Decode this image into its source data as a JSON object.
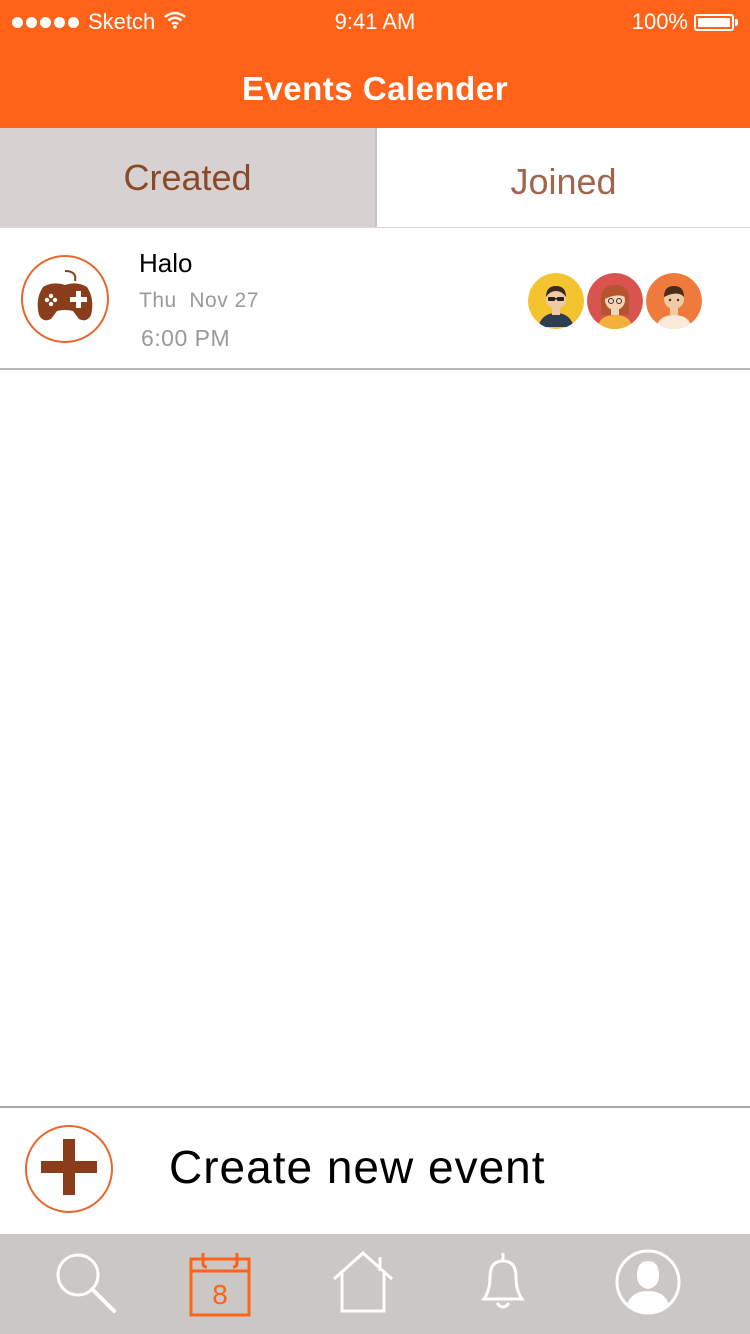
{
  "status_bar": {
    "carrier": "Sketch",
    "time": "9:41 AM",
    "battery": "100%",
    "icons": [
      "signal-dots-icon",
      "wifi-icon",
      "battery-icon"
    ]
  },
  "nav": {
    "title": "Events Calender"
  },
  "tabs": [
    {
      "label": "Created",
      "selected": true
    },
    {
      "label": "Joined",
      "selected": false
    }
  ],
  "events": [
    {
      "title": "Halo",
      "day": "Thu",
      "date": "Nov 27",
      "time": "6:00 PM",
      "icon": "gamepad-icon",
      "attendees": [
        {
          "avatar": "avatar-man-sunglasses",
          "color": "#f4c430"
        },
        {
          "avatar": "avatar-woman",
          "color": "#d9534f"
        },
        {
          "avatar": "avatar-man",
          "color": "#f07a3c"
        }
      ]
    }
  ],
  "create": {
    "label": "Create new event",
    "icon": "plus-icon"
  },
  "tab_bar": {
    "items": [
      {
        "icon": "search-icon",
        "active": false
      },
      {
        "icon": "calendar-icon",
        "active": true,
        "badge": "8"
      },
      {
        "icon": "home-icon",
        "active": false
      },
      {
        "icon": "bell-icon",
        "active": false
      },
      {
        "icon": "profile-icon",
        "active": false
      }
    ]
  },
  "colors": {
    "brand": "#ff6319",
    "accent_brown": "#8a4a2a",
    "tab_bar_bg": "#cbc7c4"
  }
}
